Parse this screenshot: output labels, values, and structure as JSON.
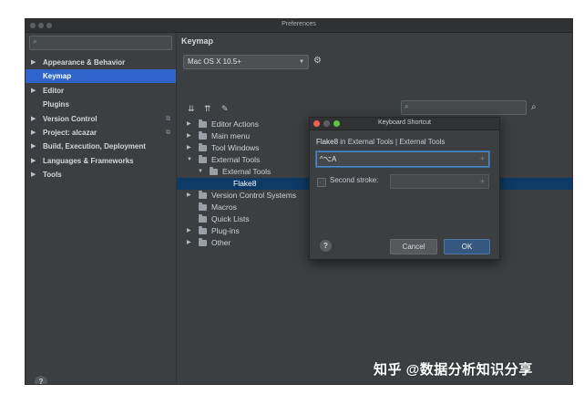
{
  "window": {
    "title": "Preferences"
  },
  "sidebar": {
    "search": {
      "placeholder": ""
    },
    "items": [
      {
        "label": "Appearance & Behavior",
        "arrow": "▶",
        "badge": ""
      },
      {
        "label": "Keymap",
        "arrow": "",
        "badge": ""
      },
      {
        "label": "Editor",
        "arrow": "▶",
        "badge": ""
      },
      {
        "label": "Plugins",
        "arrow": "",
        "badge": ""
      },
      {
        "label": "Version Control",
        "arrow": "▶",
        "badge": "⧉"
      },
      {
        "label": "Project: alcazar",
        "arrow": "▶",
        "badge": "⧉"
      },
      {
        "label": "Build, Execution, Deployment",
        "arrow": "▶",
        "badge": ""
      },
      {
        "label": "Languages & Frameworks",
        "arrow": "▶",
        "badge": ""
      },
      {
        "label": "Tools",
        "arrow": "▶",
        "badge": ""
      }
    ],
    "help_label": "?"
  },
  "keymap": {
    "title": "Keymap",
    "selected_keymap": "Mac OS X 10.5+",
    "tree": [
      {
        "label": "Editor Actions",
        "arrow": "▶"
      },
      {
        "label": "Main menu",
        "arrow": "▶"
      },
      {
        "label": "Tool Windows",
        "arrow": "▶"
      },
      {
        "label": "External Tools",
        "arrow": "▼"
      },
      {
        "label": "External Tools",
        "arrow": "▼"
      },
      {
        "label": "Flake8",
        "arrow": ""
      },
      {
        "label": "Version Control Systems",
        "arrow": "▶"
      },
      {
        "label": "Macros",
        "arrow": ""
      },
      {
        "label": "Quick Lists",
        "arrow": ""
      },
      {
        "label": "Plug-ins",
        "arrow": "▶"
      },
      {
        "label": "Other",
        "arrow": "▶"
      }
    ]
  },
  "dialog": {
    "title": "Keyboard Shortcut",
    "action_name": "Flake8",
    "action_path": "in External Tools | External Tools",
    "shortcut_value": "^⌥A",
    "second_stroke_label": "Second stroke:",
    "second_stroke_value": "",
    "help_label": "?",
    "cancel_label": "Cancel",
    "ok_label": "OK"
  },
  "watermark": "知乎 @数据分析知识分享",
  "colors": {
    "accent": "#2f65ca",
    "selection": "#0d3a66",
    "ok_button": "#365880",
    "window_bg": "#3c3f41"
  }
}
